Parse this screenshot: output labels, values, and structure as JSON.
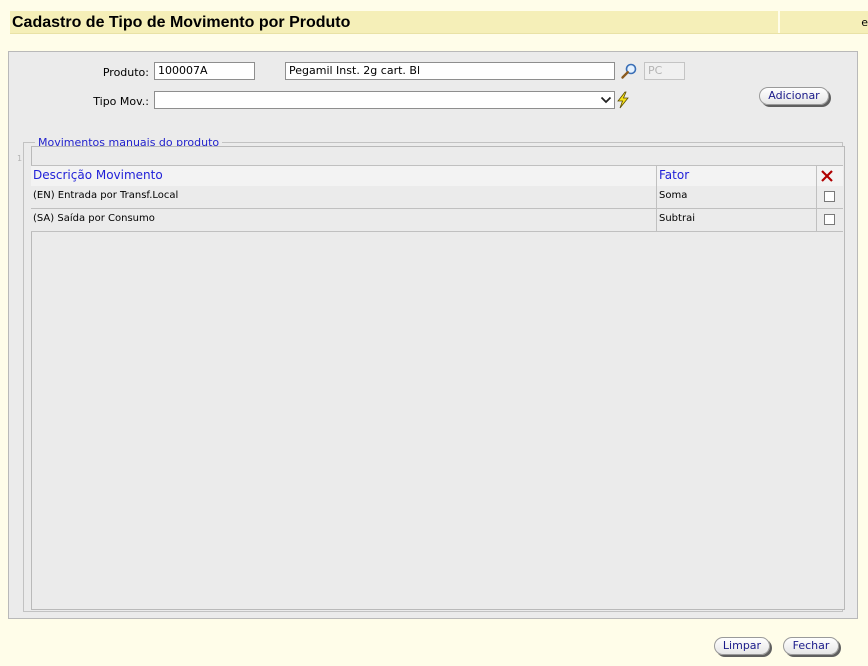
{
  "page": {
    "title": "Cadastro de Tipo de Movimento por Produto",
    "edge_text": "e"
  },
  "form": {
    "produto_label": "Produto:",
    "produto_code": "100007A",
    "produto_desc": "Pegamil Inst. 2g cart. Bl",
    "unit": "PC",
    "tipo_mov_label": "Tipo Mov.:",
    "tipo_mov_value": "",
    "add_label": "Adicionar"
  },
  "section": {
    "legend": "Movimentos manuais do produto",
    "page_number": "1",
    "headers": {
      "descricao": "Descrição Movimento",
      "fator": "Fator"
    },
    "rows": [
      {
        "descricao": "(EN) Entrada por Transf.Local",
        "fator": "Soma"
      },
      {
        "descricao": "(SA) Saída por Consumo",
        "fator": "Subtrai"
      }
    ]
  },
  "footer": {
    "limpar": "Limpar",
    "fechar": "Fechar"
  },
  "colors": {
    "title_bar": "#f5efb8",
    "background": "#fffde9",
    "panel": "#ebebeb",
    "header_text": "#1f1fd8",
    "delete_icon": "#b00000"
  }
}
